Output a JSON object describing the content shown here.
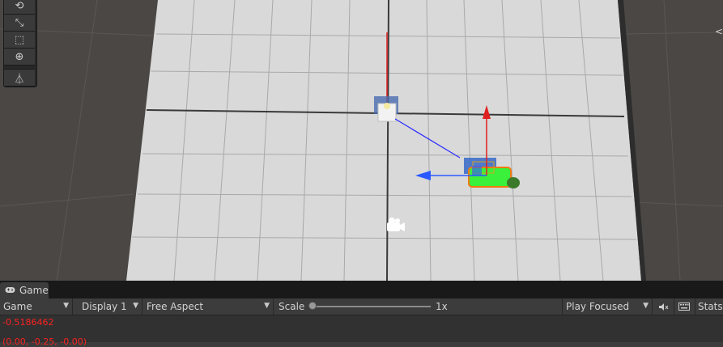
{
  "scene_view": {
    "toolbox": {
      "tools": [
        {
          "icon": "rotate-tool-icon",
          "glyph": "⟲"
        },
        {
          "icon": "scale-tool-icon",
          "glyph": "⤡"
        },
        {
          "icon": "rect-tool-icon",
          "glyph": "⬚"
        },
        {
          "icon": "transform-tool-icon",
          "glyph": "⊕"
        },
        {
          "icon": "custom-tool-icon",
          "glyph": "⏃"
        }
      ]
    },
    "view_gizmo_glyph": "<"
  },
  "game_panel": {
    "tab_label": "Game",
    "tab_icon": "gamepad-icon",
    "toolbar": {
      "view_mode": "Game",
      "display": "Display 1",
      "aspect": "Free Aspect",
      "scale_label": "Scale",
      "scale_value": "1x",
      "scale_fraction": 0.0,
      "play_mode": "Play Focused",
      "mute_icon": "mute-audio-icon",
      "keyboard_icon": "keyboard-icon",
      "stats_label": "Stats"
    },
    "console_lines": [
      "-0.5186462",
      "(0.00, -0.25, -0.00)"
    ],
    "console_color": "#ff2020"
  }
}
